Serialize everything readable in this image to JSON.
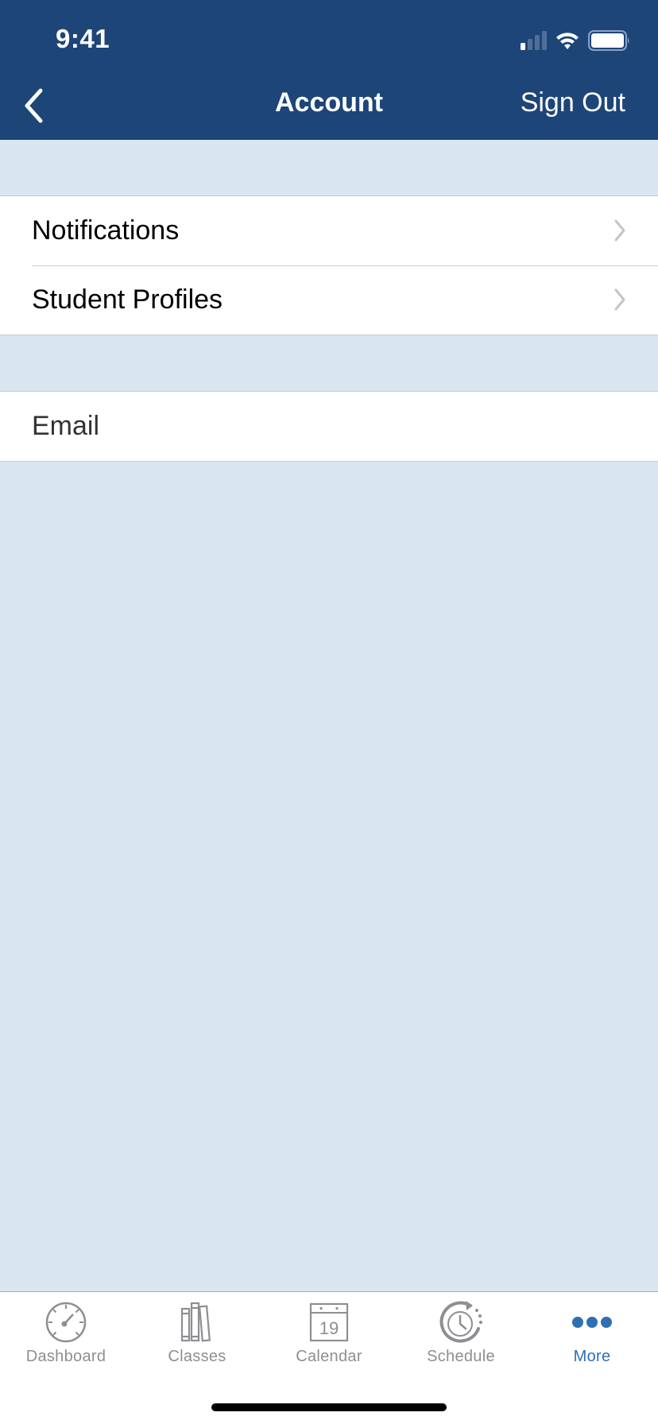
{
  "status_bar": {
    "time": "9:41",
    "signal_bars_active": 1,
    "signal_bars_total": 4,
    "icons": [
      "signal-icon",
      "wifi-icon",
      "battery-icon"
    ]
  },
  "nav": {
    "back_icon": "chevron-left-icon",
    "title": "Account",
    "sign_out_label": "Sign Out"
  },
  "sections": [
    {
      "rows": [
        {
          "label": "Notifications",
          "accessory": "chevron-right-icon"
        },
        {
          "label": "Student Profiles",
          "accessory": "chevron-right-icon"
        }
      ]
    },
    {
      "rows": [
        {
          "label": "Email",
          "accessory": ""
        }
      ]
    }
  ],
  "tabbar": {
    "items": [
      {
        "label": "Dashboard",
        "icon": "gauge-icon",
        "active": false
      },
      {
        "label": "Classes",
        "icon": "books-icon",
        "active": false
      },
      {
        "label": "Calendar",
        "icon": "calendar-icon",
        "active": false,
        "icon_text": "19"
      },
      {
        "label": "Schedule",
        "icon": "clock-refresh-icon",
        "active": false
      },
      {
        "label": "More",
        "icon": "more-dots-icon",
        "active": true
      }
    ]
  },
  "colors": {
    "header_bg": "#1e4578",
    "page_bg": "#d9e6f0",
    "active_tab": "#2f6fb3",
    "inactive_tab": "#8e8e93"
  }
}
